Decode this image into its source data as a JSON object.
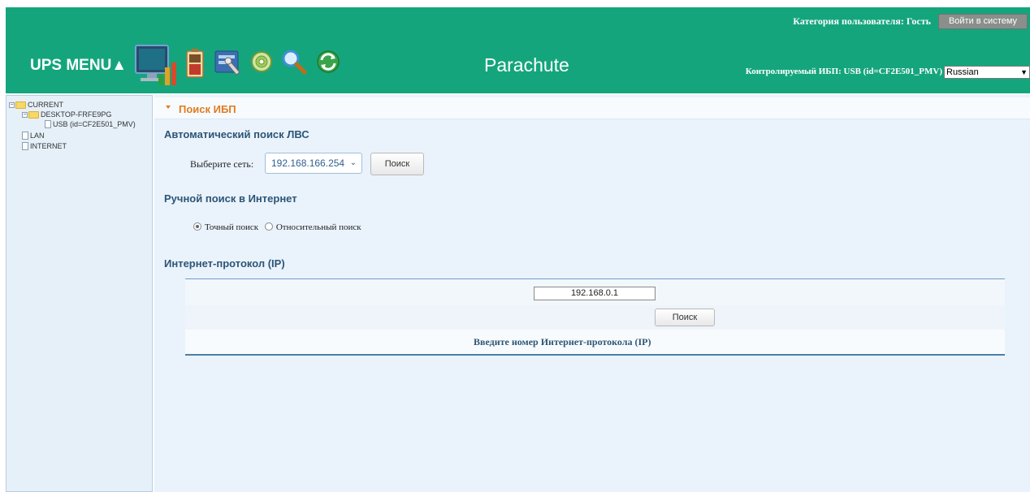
{
  "header": {
    "user_category": "Категория пользователя: Гость",
    "login_button": "Войти в систему",
    "ups_menu": "UPS MENU▲",
    "product_name": "Parachute",
    "monitored_ups": "Контролируемый ИБП: USB (id=CF2E501_PMV)",
    "language": "Russian",
    "toolbar_icons": [
      "monitor-chart-icon",
      "battery-icon",
      "settings-tools-icon",
      "disc-icon",
      "magnifier-icon",
      "refresh-icon"
    ]
  },
  "sidebar": {
    "tree": {
      "current": "CURRENT",
      "host": "DESKTOP-FRFE9PG",
      "usb": "USB (id=CF2E501_PMV)",
      "lan": "LAN",
      "internet": "INTERNET"
    }
  },
  "main": {
    "title": "Поиск ИБП",
    "auto_search": {
      "heading": "Автоматический поиск ЛВС",
      "network_label": "Выберите сеть:",
      "network_value": "192.168.166.254",
      "search_button": "Поиск"
    },
    "manual_search": {
      "heading": "Ручной поиск в Интернет",
      "exact_label": "Точный поиск",
      "relative_label": "Относительный поиск",
      "selected": "exact"
    },
    "ip": {
      "heading": "Интернет-протокол (IP)",
      "value": "192.168.0.1",
      "prompt": "Введите номер Интернет-протокола (IP)",
      "search_button": "Поиск"
    }
  },
  "colors": {
    "header_bg": "#15a57d",
    "accent_orange": "#e07c1f",
    "heading_blue": "#2c5577",
    "panel_bg": "#eaf3fb"
  }
}
